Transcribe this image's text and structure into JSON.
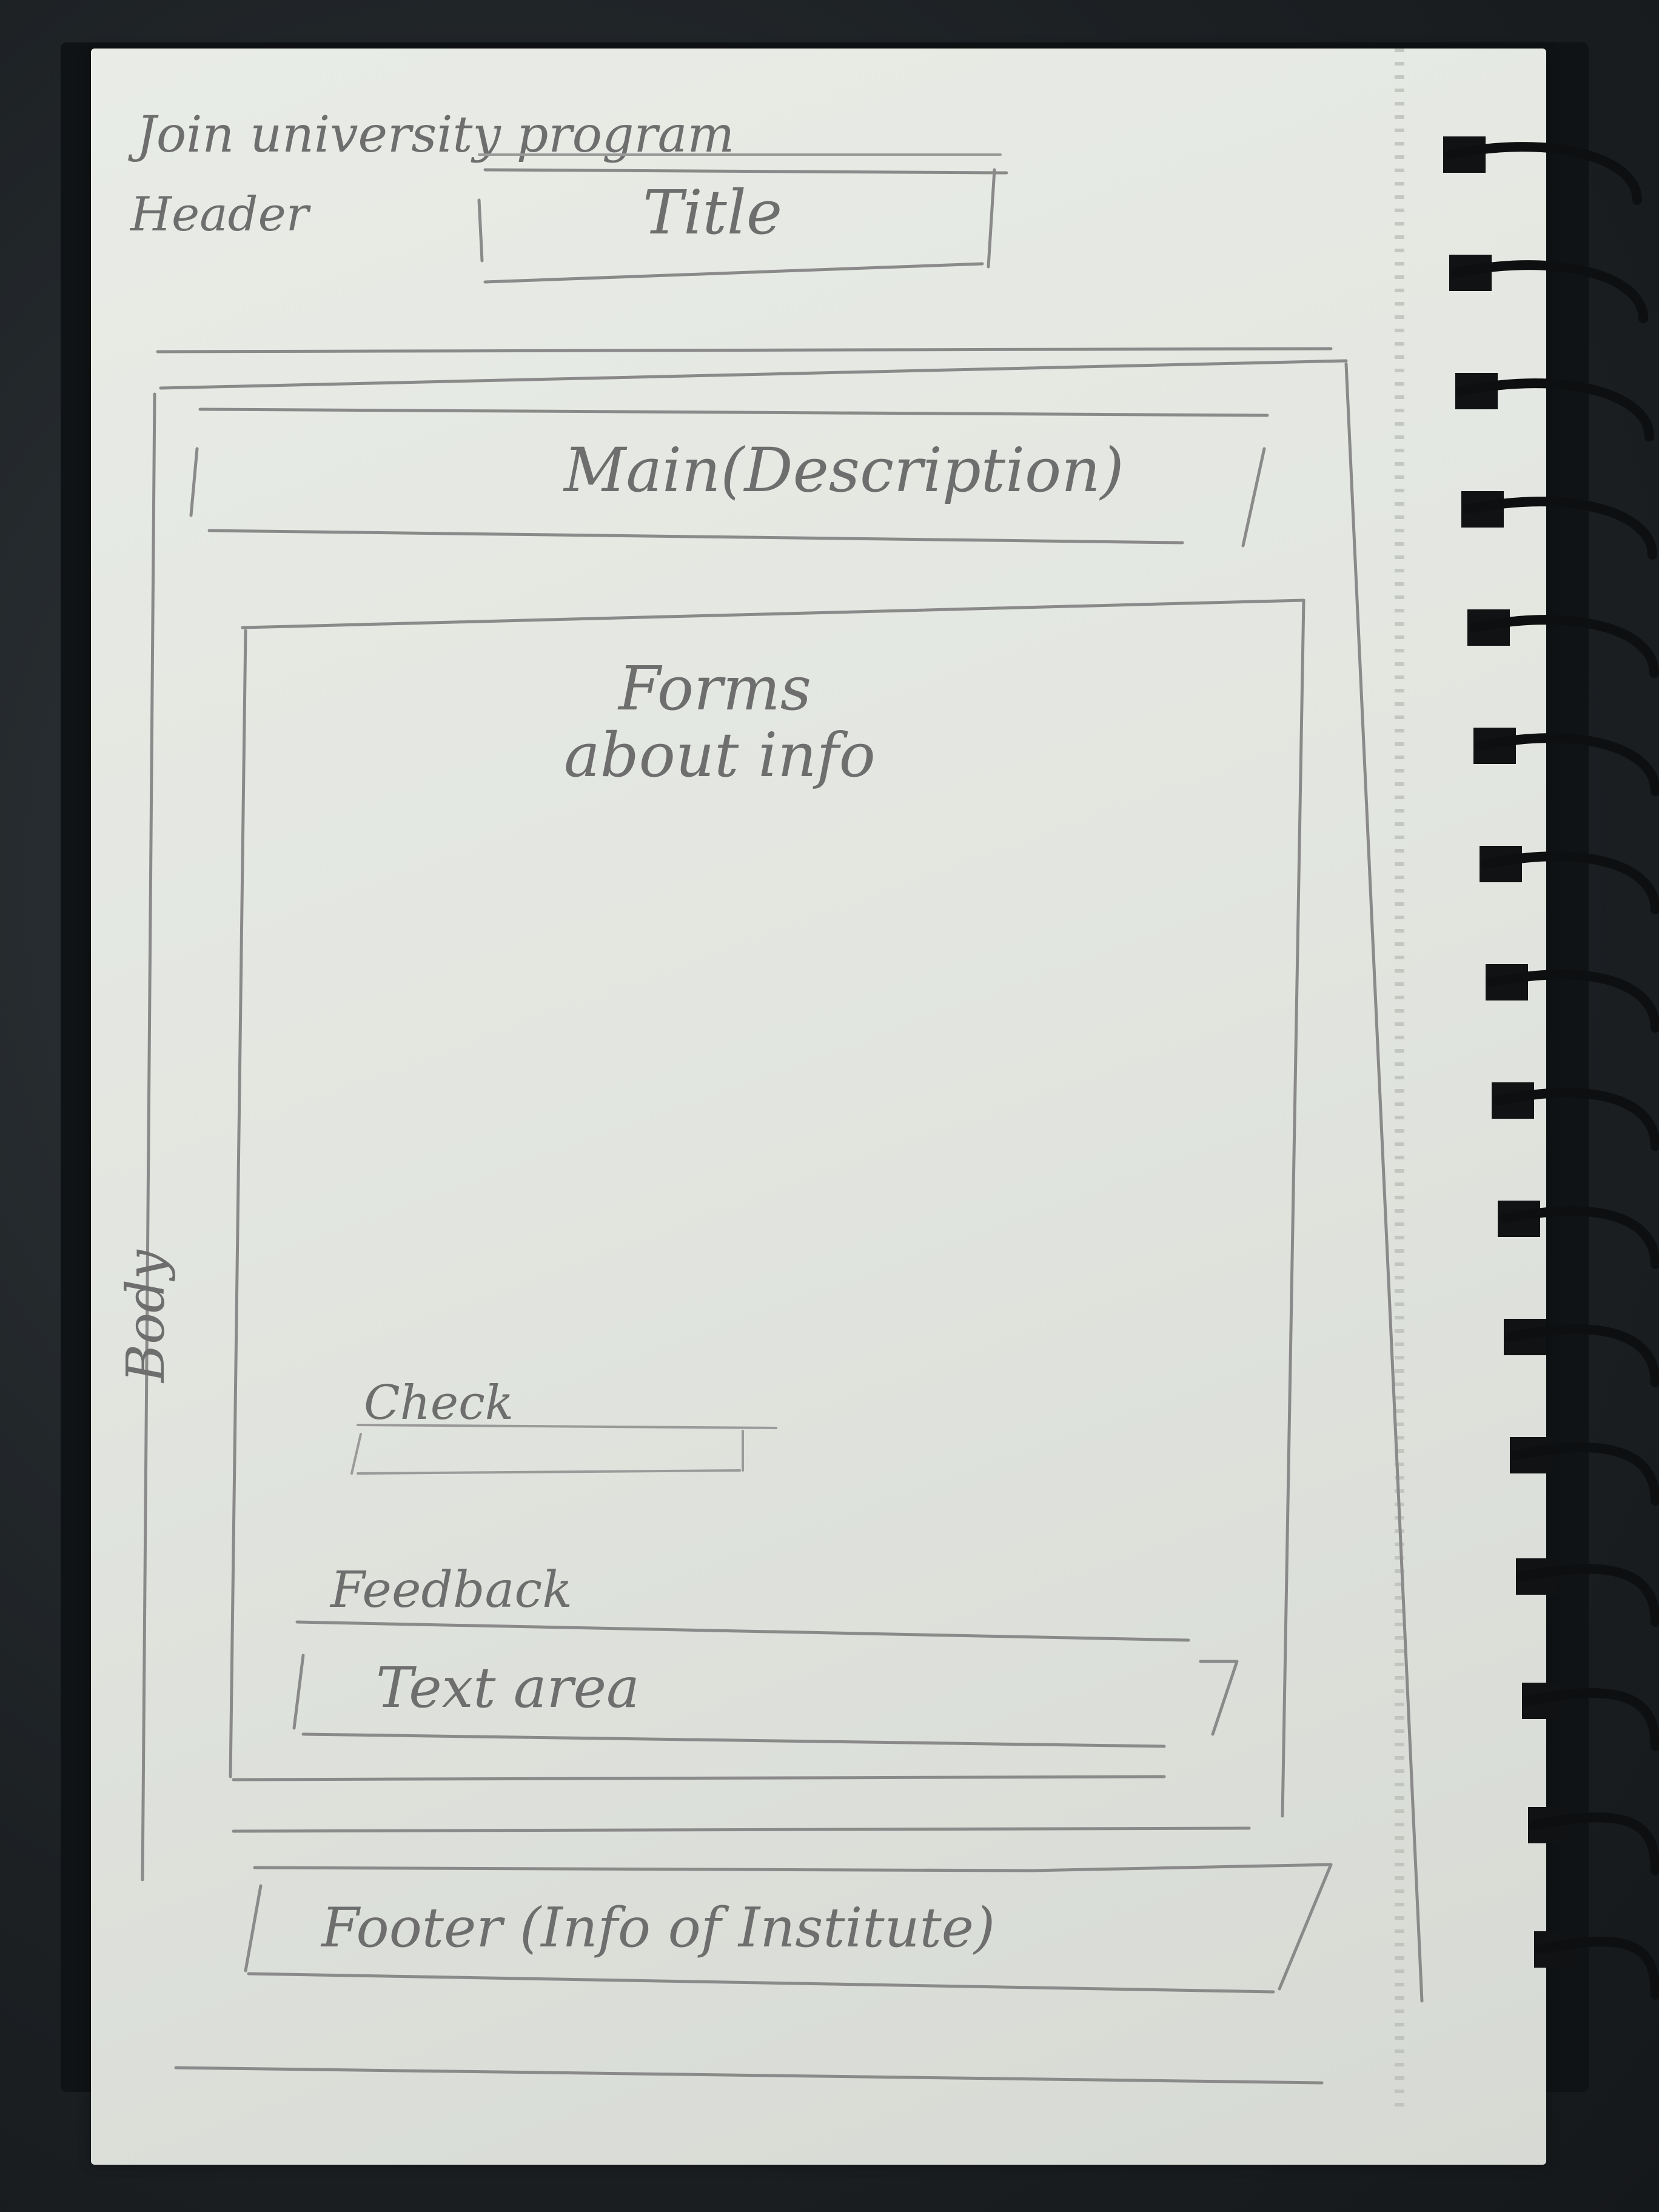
{
  "sketch": {
    "top_note": "Join university program",
    "header_label": "Header",
    "title_box": "Title",
    "main_box": "Main(Description)",
    "forms_line1": "Forms",
    "forms_line2": "about info",
    "body_label": "Body",
    "check_label": "Check",
    "feedback_label": "Feedback",
    "textarea_label": "Text area",
    "footer_box": "Footer (Info of Institute)"
  },
  "colors": {
    "paper": "#e6e9e3",
    "pencil": "#7a7a7a",
    "spiral": "#0d0f10"
  }
}
